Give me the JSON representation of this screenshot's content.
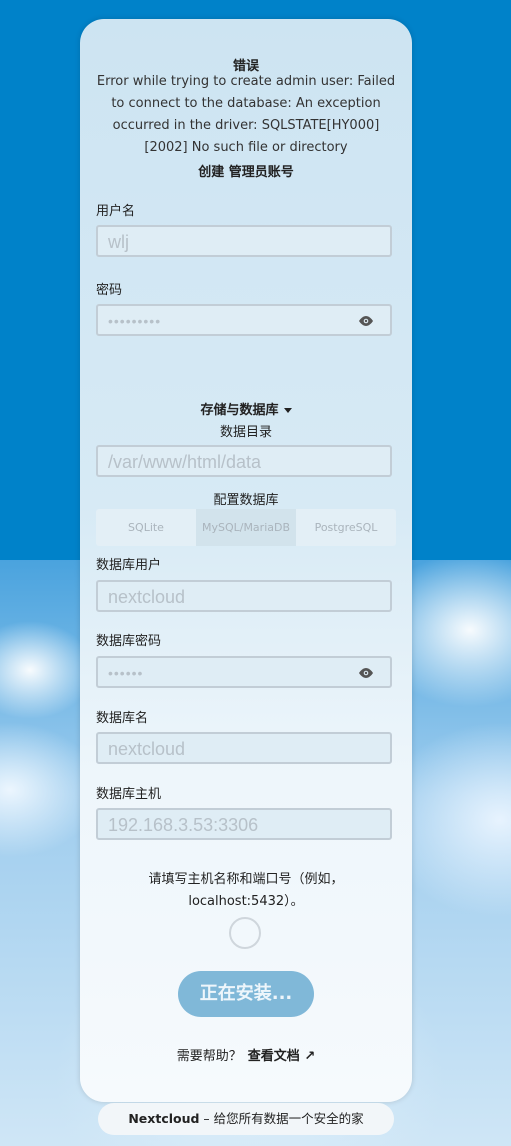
{
  "error": {
    "title": "错误",
    "message": "Error while trying to create admin user: Failed to connect to the database: An exception occurred in the driver: SQLSTATE[HY000] [2002] No such file or directory"
  },
  "admin": {
    "title": "创建 管理员账号",
    "username_label": "用户名",
    "username_value": "wlj",
    "password_label": "密码",
    "password_value": "•••••••••"
  },
  "storage": {
    "toggle_label": "存储与数据库",
    "datadir_label": "数据目录",
    "datadir_value": "/var/www/html/data",
    "config_db_label": "配置数据库",
    "db_tabs": [
      "SQLite",
      "MySQL/MariaDB",
      "PostgreSQL"
    ],
    "active_tab": "MySQL/MariaDB",
    "db_user_label": "数据库用户",
    "db_user_value": "nextcloud",
    "db_pass_label": "数据库密码",
    "db_pass_value": "••••••",
    "db_name_label": "数据库名",
    "db_name_value": "nextcloud",
    "db_host_label": "数据库主机",
    "db_host_value": "192.168.3.53:3306",
    "db_host_hint": "请填写主机名称和端口号（例如，localhost:5432）。"
  },
  "install_button": "正在安装...",
  "help": {
    "text": "需要帮助？",
    "link": "查看文档 ↗"
  },
  "footer": {
    "brand": "Nextcloud",
    "text": " – 给您所有数据一个安全的家"
  }
}
